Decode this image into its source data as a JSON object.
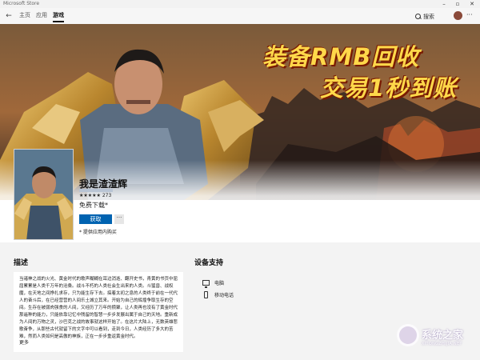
{
  "window": {
    "title": "Microsoft Store"
  },
  "nav": {
    "tabs": [
      {
        "label": "主页"
      },
      {
        "label": "应用"
      },
      {
        "label": "游戏"
      }
    ],
    "search_label": "搜索",
    "more_label": "···"
  },
  "hero": {
    "line1": "装备RMB回收",
    "line2": "交易1秒到账"
  },
  "app": {
    "name": "我是渣渣辉",
    "stars": "★★★★★",
    "rating_count": "273",
    "price": "免费下载*",
    "get_label": "获取",
    "more_label": "···",
    "iap_note": "* 提供应用内购买"
  },
  "description": {
    "title": "描述",
    "text": "当诸神之战的火光、黄金时代的歌声糊糊在耳边消逝、翻开史书，青黄的书页中屈屈累累是人类千万年的沧桑。战斗不朽的人类社会生出来的人类。斗猛兽、战权魔，在天地之间挣扎求存，只为能生存下去。搞着太初之息的人类终于前在一代代人的奋斗后，在已经营营的人间乐土城立其来。开始为自己的辉煌争取生存的空间。生存在被弱肉强食的人间，又经历了万年的攒聚，让人类再也没有了黄金时代那遥种的能力，只能依靠记忆中残留的智慧一步步发展出属于自己的天地。重新成为人间的万物之灵，沙巴克之战的故事就这样开始了。在这片大陆上，无数英雄悲歌奋争，从那些古代就留下的文字中可以看到，走到今日，人类经历了多大的苦难，然而人类如何是高傲的神族，正在一步步重返黄金时代。",
    "more_label": "更多"
  },
  "devices": {
    "title": "设备支持",
    "items": [
      {
        "icon": "pc-icon",
        "label": "电脑"
      },
      {
        "icon": "phone-icon",
        "label": "移动电话"
      }
    ]
  },
  "watermark": {
    "text": "系统之家",
    "sub": "XITONGZHIJIA.NET"
  },
  "colors": {
    "accent": "#0063b1",
    "hero_text": "#ffd84a"
  }
}
